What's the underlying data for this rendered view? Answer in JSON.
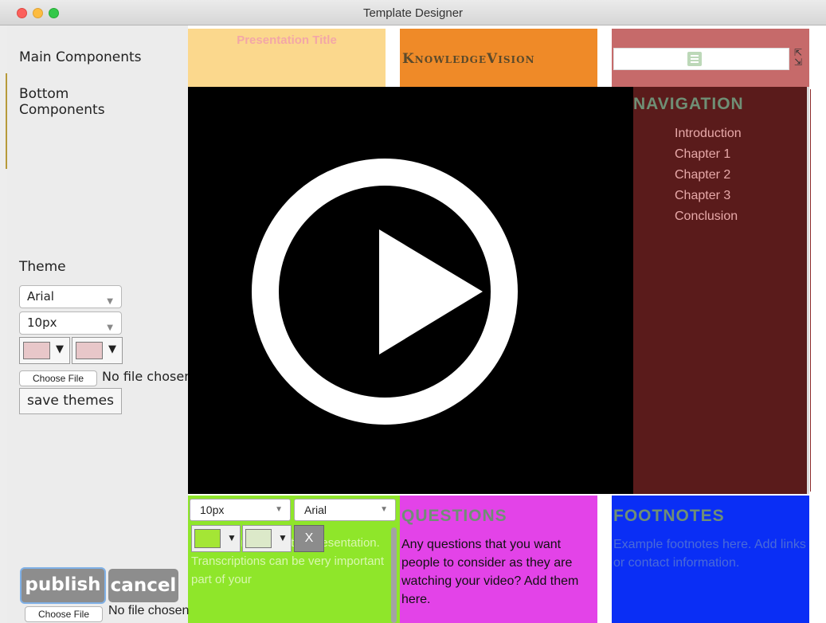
{
  "window": {
    "title": "Template Designer"
  },
  "left_panel": {
    "main_components": "Main Components",
    "bottom_components": "Bottom Components",
    "theme_label": "Theme",
    "font_select": "Arial",
    "size_select": "10px",
    "color1": "#e8c7c9",
    "color2": "#e8c7c9",
    "choose_file": "Choose File",
    "no_file": "No file chosen",
    "save_themes": "save themes",
    "publish": "publish",
    "cancel": "cancel",
    "choose_file_bottom": "Choose File",
    "no_file_bottom": "No file chosen"
  },
  "header": {
    "presentation_title": "Presentation Title",
    "logo_text": "KnowledgeVision"
  },
  "navigation": {
    "title": "NAVIGATION",
    "items": [
      "Introduction",
      "Chapter 1",
      "Chapter 2",
      "Chapter 3",
      "Conclusion"
    ]
  },
  "notes": {
    "size_select": "10px",
    "font_select": "Arial",
    "color1": "#a4e635",
    "color2": "#dce9c9",
    "close_label": "X",
    "text": "Example notes for the presentation. Transcriptions can be very important part of your"
  },
  "questions": {
    "title": "QUESTIONS",
    "text": "Any questions that you want people to consider as they are watching your video? Add them here."
  },
  "footnotes": {
    "title": "FOOTNOTES",
    "text": "Example footnotes here. Add links or contact information."
  },
  "colors": {
    "notes_bg": "#8fe62a",
    "questions_bg": "#e343e8",
    "footnotes_bg": "#0a2ef5",
    "nav_bg": "#5a1b1b",
    "title_bg": "#fbd88d",
    "logo_bg": "#ef8a28",
    "search_bg": "#c66a6a"
  }
}
